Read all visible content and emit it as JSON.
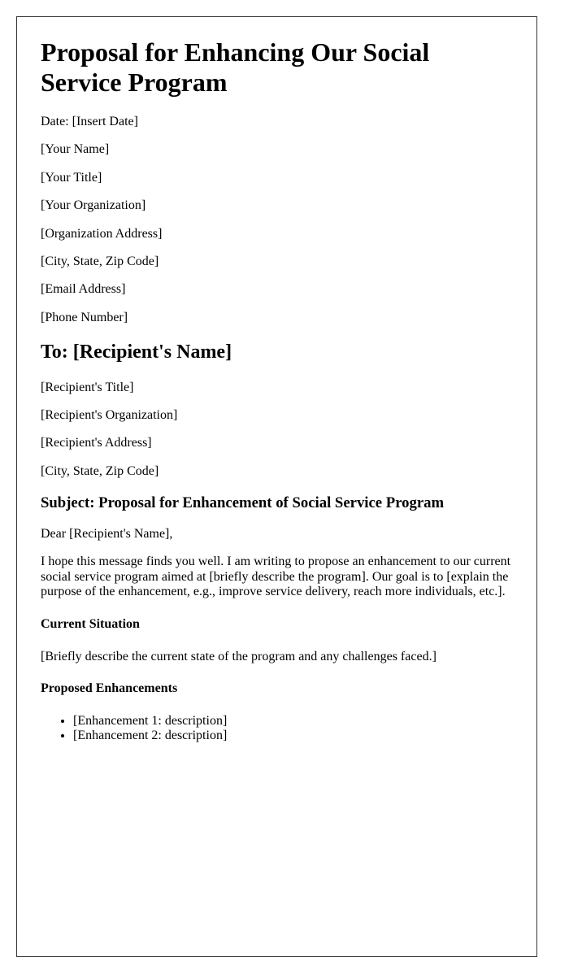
{
  "document": {
    "title": "Proposal for Enhancing Our Social Service Program",
    "sender": {
      "date_line": "Date: [Insert Date]",
      "name": "[Your Name]",
      "title": "[Your Title]",
      "organization": "[Your Organization]",
      "address": "[Organization Address]",
      "city_state_zip": "[City, State, Zip Code]",
      "email": "[Email Address]",
      "phone": "[Phone Number]"
    },
    "recipient": {
      "heading": "To: [Recipient's Name]",
      "title": "[Recipient's Title]",
      "organization": "[Recipient's Organization]",
      "address": "[Recipient's Address]",
      "city_state_zip": "[City, State, Zip Code]"
    },
    "subject": "Subject: Proposal for Enhancement of Social Service Program",
    "salutation": "Dear [Recipient's Name],",
    "intro": "I hope this message finds you well. I am writing to propose an enhancement to our current social service program aimed at [briefly describe the program]. Our goal is to [explain the purpose of the enhancement, e.g., improve service delivery, reach more individuals, etc.].",
    "sections": {
      "current_situation": {
        "heading": "Current Situation",
        "body": "[Briefly describe the current state of the program and any challenges faced.]"
      },
      "proposed_enhancements": {
        "heading": "Proposed Enhancements",
        "items": [
          "[Enhancement 1: description]",
          "[Enhancement 2: description]"
        ]
      }
    }
  }
}
